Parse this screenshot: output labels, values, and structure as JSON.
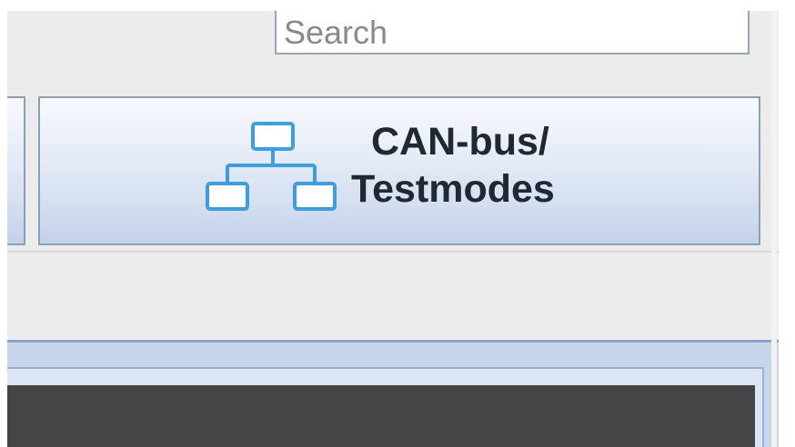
{
  "search": {
    "placeholder": "Search"
  },
  "toolbar": {
    "can_button": {
      "label_line1": "CAN-bus/",
      "label_line2": "Testmodes",
      "icon": "network-tree-icon",
      "icon_color": "#3a9ee0"
    },
    "partial_button_left": {
      "visible": true
    }
  },
  "colors": {
    "window_bg": "#ececec",
    "button_border": "#8a9fb8",
    "panel_dark": "#454545"
  }
}
